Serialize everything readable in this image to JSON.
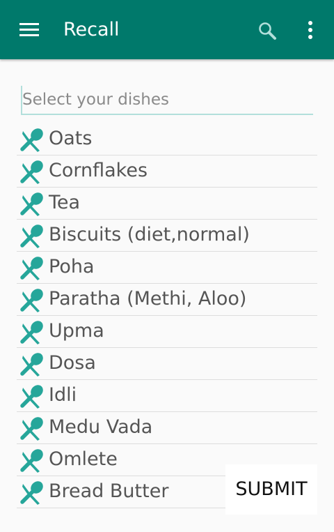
{
  "appbar": {
    "title": "Recall",
    "menu_icon": "hamburger-menu-icon",
    "search_icon": "search-icon",
    "more_icon": "more-vert-icon"
  },
  "search": {
    "placeholder": "Select your dishes",
    "value": ""
  },
  "dish_icon": "spoon-knife-icon",
  "dishes": [
    {
      "label": "Oats"
    },
    {
      "label": "Cornflakes"
    },
    {
      "label": "Tea"
    },
    {
      "label": "Biscuits (diet,normal)"
    },
    {
      "label": "Poha"
    },
    {
      "label": "Paratha (Methi, Aloo)"
    },
    {
      "label": "Upma"
    },
    {
      "label": "Dosa"
    },
    {
      "label": "Idli"
    },
    {
      "label": "Medu Vada"
    },
    {
      "label": "Omlete"
    },
    {
      "label": "Bread Butter"
    },
    {
      "label": ""
    }
  ],
  "submit": {
    "label": "SUBMIT"
  },
  "colors": {
    "primary": "#00796b",
    "icon_accent": "#26a69a",
    "field_underline": "#b2dfdb"
  }
}
